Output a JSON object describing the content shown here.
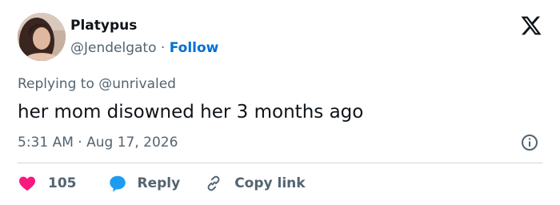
{
  "author": {
    "name": "Platypus",
    "handle": "@Jendelgato",
    "separator": "·",
    "follow_label": "Follow"
  },
  "logo_icon": "x-logo-icon",
  "replying": {
    "prefix": "Replying to",
    "mention": "@unrivaled"
  },
  "tweet_text": "her mom disowned her 3 months ago",
  "meta": {
    "time": "5:31 AM",
    "separator": "·",
    "date": "Aug 17, 2026",
    "info_icon": "info-icon"
  },
  "actions": {
    "like_count": "105",
    "reply_label": "Reply",
    "copy_label": "Copy link"
  },
  "colors": {
    "like": "#f91880",
    "reply": "#1d9bf0",
    "link": "#006fd6",
    "muted": "#536471",
    "text": "#0f1419",
    "divider": "#cfd9de"
  }
}
